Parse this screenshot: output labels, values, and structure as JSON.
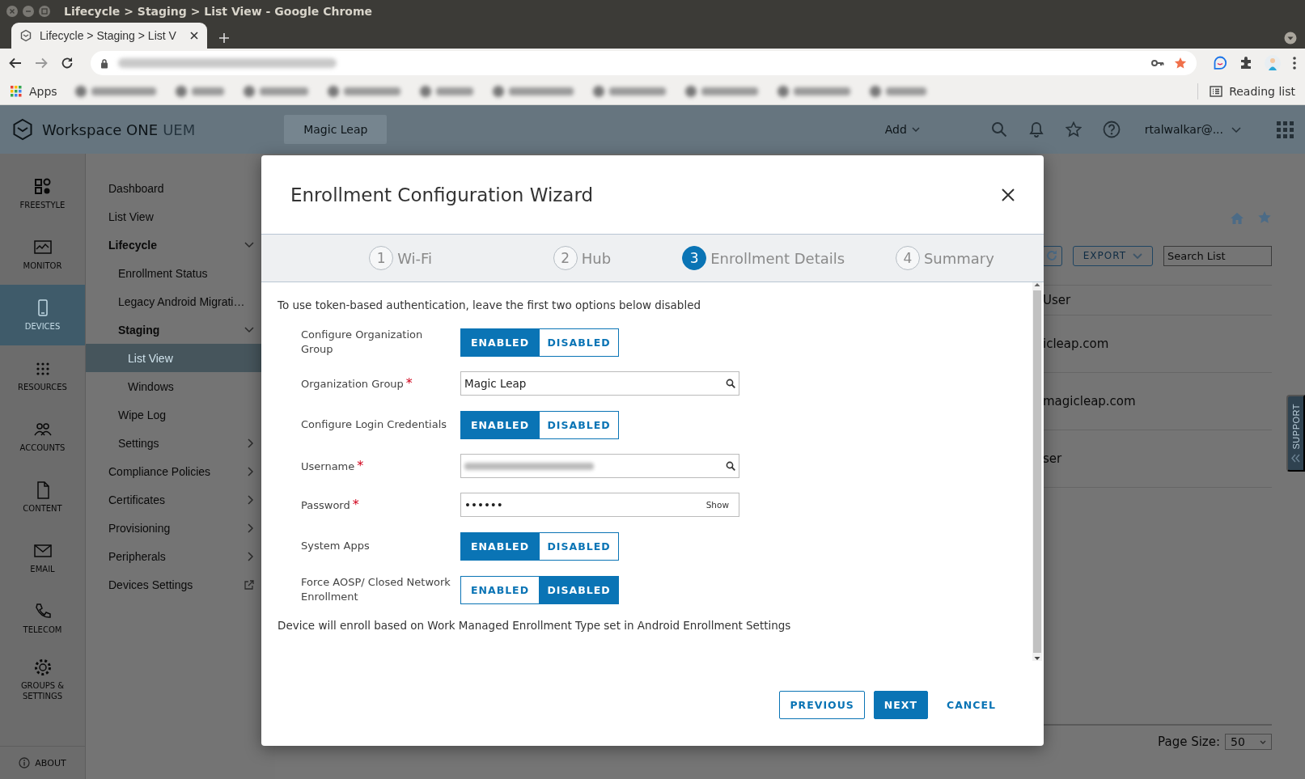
{
  "browser": {
    "window_title": "Lifecycle > Staging > List View - Google Chrome",
    "tab_title": "Lifecycle > Staging > List V",
    "apps_label": "Apps",
    "reading_list": "Reading list"
  },
  "app": {
    "product": "Workspace ONE",
    "product_suffix": "UEM",
    "org": "Magic Leap",
    "add": "Add",
    "user": "rtalwalkar@...",
    "rail": [
      {
        "label": "FREESTYLE",
        "selected": false
      },
      {
        "label": "MONITOR",
        "selected": false
      },
      {
        "label": "DEVICES",
        "selected": true
      },
      {
        "label": "RESOURCES",
        "selected": false
      },
      {
        "label": "ACCOUNTS",
        "selected": false
      },
      {
        "label": "CONTENT",
        "selected": false
      },
      {
        "label": "EMAIL",
        "selected": false
      },
      {
        "label": "TELECOM",
        "selected": false
      },
      {
        "label": "GROUPS & SETTINGS",
        "selected": false
      }
    ],
    "about": "ABOUT",
    "nav": [
      {
        "label": "Dashboard",
        "selected": false
      },
      {
        "label": "List View",
        "selected": false
      },
      {
        "label": "Lifecycle",
        "selected": false,
        "expanded": true,
        "children": [
          {
            "label": "Enrollment Status",
            "selected": false
          },
          {
            "label": "Legacy Android Migrati…",
            "selected": false
          },
          {
            "label": "Staging",
            "selected": false,
            "expanded": true,
            "children": [
              {
                "label": "List View",
                "selected": true
              },
              {
                "label": "Windows",
                "selected": false
              }
            ]
          },
          {
            "label": "Wipe Log",
            "selected": false
          },
          {
            "label": "Settings",
            "selected": false,
            "expanded": false
          }
        ]
      },
      {
        "label": "Compliance Policies",
        "selected": false,
        "expanded": false
      },
      {
        "label": "Certificates",
        "selected": false,
        "expanded": false
      },
      {
        "label": "Provisioning",
        "selected": false,
        "expanded": false
      },
      {
        "label": "Peripherals",
        "selected": false,
        "expanded": false
      },
      {
        "label": "Devices Settings",
        "selected": false,
        "external": true
      }
    ],
    "toolbar": {
      "export": "EXPORT",
      "search_placeholder": "Search List"
    },
    "table": {
      "columns": [
        "User"
      ],
      "rows": [
        [
          "icleap.com"
        ],
        [
          "magicleap.com"
        ],
        [
          "ser"
        ]
      ]
    },
    "page_size_label": "Page Size:",
    "page_size": "50",
    "support": "SUPPORT"
  },
  "modal": {
    "title": "Enrollment Configuration Wizard",
    "steps": [
      {
        "number": "1",
        "label": "Wi-Fi",
        "selected": false
      },
      {
        "number": "2",
        "label": "Hub",
        "selected": false
      },
      {
        "number": "3",
        "label": "Enrollment Details",
        "selected": true
      },
      {
        "number": "4",
        "label": "Summary",
        "selected": false
      }
    ],
    "intro": "To use token-based authentication, leave the first two options below disabled",
    "fields": [
      {
        "kind": "toggle",
        "label": "Configure Organization Group",
        "on_label": "ENABLED",
        "off_label": "DISABLED",
        "enabled": true
      },
      {
        "kind": "lookup",
        "label": "Organization Group",
        "required_mark": "*",
        "value": "Magic Leap"
      },
      {
        "kind": "toggle",
        "label": "Configure Login Credentials",
        "on_label": "ENABLED",
        "off_label": "DISABLED",
        "enabled": true
      },
      {
        "kind": "lookup",
        "label": "Username",
        "required_mark": "*",
        "redacted": true
      },
      {
        "kind": "password",
        "label": "Password",
        "required_mark": "*",
        "value": "••••••",
        "reveal": "Show"
      },
      {
        "kind": "toggle",
        "label": "System Apps",
        "on_label": "ENABLED",
        "off_label": "DISABLED",
        "enabled": true
      },
      {
        "kind": "toggle",
        "label": "Force AOSP/ Closed Network Enrollment",
        "on_label": "ENABLED",
        "off_label": "DISABLED",
        "enabled": false
      }
    ],
    "note": "Device will enroll based on Work Managed Enrollment Type set in Android Enrollment Settings",
    "buttons": [
      {
        "kind": "outline",
        "label": "PREVIOUS"
      },
      {
        "kind": "primary",
        "label": "NEXT"
      },
      {
        "kind": "link",
        "label": "CANCEL"
      }
    ]
  }
}
